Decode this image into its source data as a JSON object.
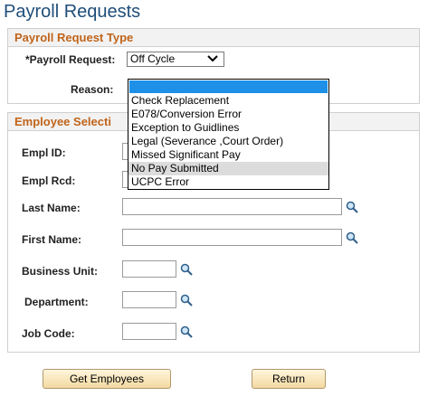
{
  "page": {
    "title": "Payroll Requests"
  },
  "request_type": {
    "header": "Payroll Request Type",
    "payroll_request_label": "*Payroll Request:",
    "payroll_request_value": "Off Cycle",
    "reason_label": "Reason:"
  },
  "reason_dropdown": {
    "options": [
      "Check Replacement",
      "E078/Conversion Error",
      "Exception to Guidlines",
      "Legal (Severance ,Court Order)",
      "Missed Significant Pay",
      "No Pay Submitted",
      "UCPC Error"
    ],
    "hovered": "No Pay Submitted"
  },
  "employee_selection": {
    "header": "Employee Selecti",
    "empl_id_label": "Empl ID:",
    "empl_rcd_label": "Empl Rcd:",
    "last_name_label": "Last Name:",
    "first_name_label": "First Name:",
    "business_unit_label": "Business Unit:",
    "department_label": "Department:",
    "job_code_label": "Job Code:"
  },
  "buttons": {
    "get_employees": "Get Employees",
    "return": "Return"
  },
  "colors": {
    "title": "#1f4e79",
    "section_header": "#c0641a",
    "highlight": "#1e90e8"
  },
  "icons": [
    "chevron-down-icon",
    "magnifier-icon"
  ]
}
